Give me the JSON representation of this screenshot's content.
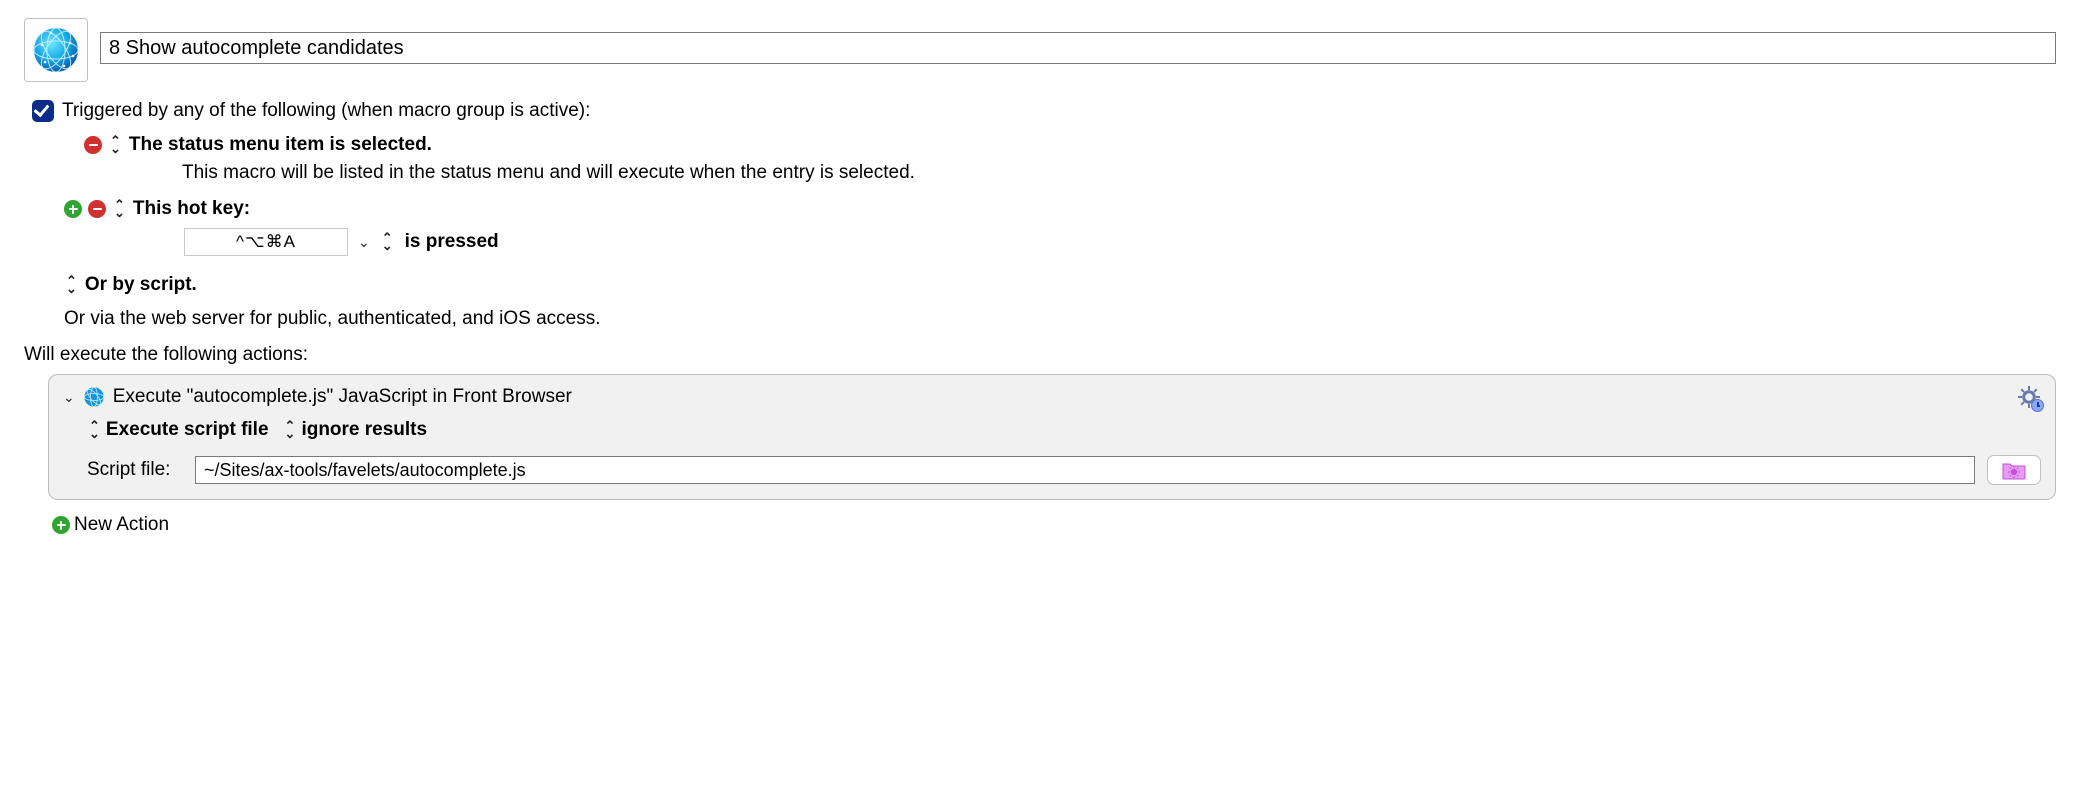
{
  "macro": {
    "title": "8 Show autocomplete candidates"
  },
  "triggers": {
    "enabled_label": "Triggered by any of the following (when macro group is active):",
    "status_menu": {
      "title": "The status menu item is selected.",
      "desc": "This macro will be listed in the status menu and will execute when the entry is selected."
    },
    "hotkey": {
      "title": "This hot key:",
      "combo": "^⌥⌘A",
      "condition": "is pressed"
    },
    "or_script": "Or by script.",
    "web_server": "Or via the web server for public, authenticated, and iOS access."
  },
  "actions": {
    "heading": "Will execute the following actions:",
    "item": {
      "title": "Execute \"autocomplete.js\" JavaScript in Front Browser",
      "opt1": "Execute script file",
      "opt2": "ignore results",
      "script_label": "Script file:",
      "script_path": "~/Sites/ax-tools/favelets/autocomplete.js"
    },
    "new_action": "New Action"
  }
}
